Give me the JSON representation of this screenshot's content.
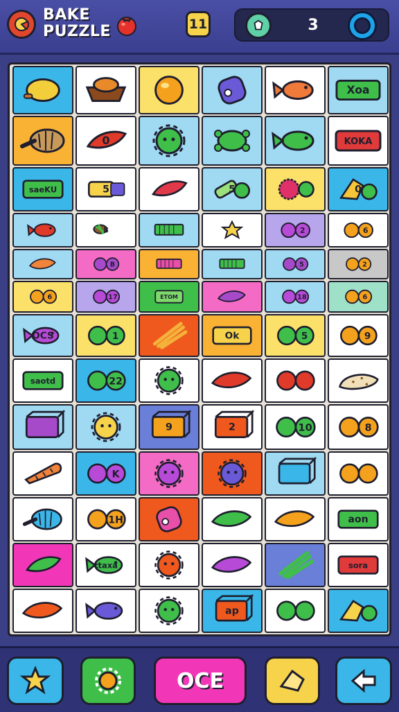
{
  "header": {
    "title_line1": "BAKE",
    "title_line2": "PUZZLE",
    "level": "11",
    "gem_count": "3"
  },
  "board": {
    "rows": [
      [
        {
          "bg": "#3ab7e8",
          "icon": "lemon",
          "c": "#f2cf3a",
          "t": ""
        },
        {
          "bg": "#ffffff",
          "icon": "basket",
          "c": "#e88a2a",
          "t": ""
        },
        {
          "bg": "#fbe06a",
          "icon": "orange",
          "c": "#f4a21e",
          "t": ""
        },
        {
          "bg": "#9fd9f2",
          "icon": "jar",
          "c": "#6a5ad8",
          "t": ""
        },
        {
          "bg": "#ffffff",
          "icon": "fish",
          "c": "#f07a3a",
          "t": ""
        },
        {
          "bg": "#9fd9f2",
          "icon": "tag",
          "c": "#3fbf4a",
          "t": "Xoa"
        }
      ],
      [
        {
          "bg": "#f9b234",
          "icon": "shell",
          "c": "#c89a5a",
          "t": ""
        },
        {
          "bg": "#ffffff",
          "icon": "pepper",
          "c": "#e03a2a",
          "t": "0"
        },
        {
          "bg": "#9fd9f2",
          "icon": "sun",
          "c": "#3fbf4a",
          "t": ""
        },
        {
          "bg": "#9fd9f2",
          "icon": "turtle",
          "c": "#3fbf4a",
          "t": ""
        },
        {
          "bg": "#9fd9f2",
          "icon": "fish",
          "c": "#3fbf4a",
          "t": ""
        },
        {
          "bg": "#ffffff",
          "icon": "tag",
          "c": "#e03a3a",
          "t": "KOKA"
        }
      ],
      [
        {
          "bg": "#3ab7e8",
          "icon": "tag",
          "c": "#3fbf4a",
          "t": "saeKU"
        },
        {
          "bg": "#ffffff",
          "icon": "tube",
          "c": "#f7d34b",
          "t": "5"
        },
        {
          "bg": "#ffffff",
          "icon": "pepper",
          "c": "#e03a4a",
          "t": ""
        },
        {
          "bg": "#9fd9f2",
          "icon": "bottle",
          "c": "#9be07a",
          "t": "5"
        },
        {
          "bg": "#fbe06a",
          "icon": "berry",
          "c": "#e0306a",
          "t": ""
        },
        {
          "bg": "#3ab7e8",
          "icon": "cake",
          "c": "#f7c53a",
          "t": "0"
        }
      ],
      [
        {
          "bg": "#9fd9f2",
          "icon": "fish",
          "c": "#e03a2a",
          "t": ""
        },
        {
          "bg": "#ffffff",
          "icon": "candy",
          "c": "#8a5a2a",
          "t": "8"
        },
        {
          "bg": "#9fd9f2",
          "icon": "bar",
          "c": "#3fbf4a",
          "t": ""
        },
        {
          "bg": "#ffffff",
          "icon": "star",
          "c": "#f7d34b",
          "t": ""
        },
        {
          "bg": "#b7a6ec",
          "icon": "pair",
          "c": "#b84ad8",
          "t": "2"
        },
        {
          "bg": "#ffffff",
          "icon": "pair",
          "c": "#f4a21e",
          "t": "6"
        }
      ],
      [
        {
          "bg": "#9fd9f2",
          "icon": "leaf",
          "c": "#f0843a",
          "t": ""
        },
        {
          "bg": "#f36bc5",
          "icon": "pair",
          "c": "#a64ac9",
          "t": "B"
        },
        {
          "bg": "#f9b234",
          "icon": "bar",
          "c": "#e84fa8",
          "t": ""
        },
        {
          "bg": "#9fd9f2",
          "icon": "bar",
          "c": "#3fbf4a",
          "t": ""
        },
        {
          "bg": "#9fd9f2",
          "icon": "pair",
          "c": "#a64ac9",
          "t": "5"
        },
        {
          "bg": "#c8c8c8",
          "icon": "pair",
          "c": "#f4a21e",
          "t": "2"
        }
      ],
      [
        {
          "bg": "#fbe06a",
          "icon": "pair",
          "c": "#f4a21e",
          "t": "6"
        },
        {
          "bg": "#b7a6ec",
          "icon": "pair",
          "c": "#b84ad8",
          "t": "17"
        },
        {
          "bg": "#3fbf4a",
          "icon": "tag",
          "c": "#7ed86a",
          "t": "ETOM"
        },
        {
          "bg": "#f36bc5",
          "icon": "leaf",
          "c": "#a64ac9",
          "t": ""
        },
        {
          "bg": "#9fd9f2",
          "icon": "pair",
          "c": "#b84ad8",
          "t": "18"
        },
        {
          "bg": "#9fe0c9",
          "icon": "pair",
          "c": "#f4a21e",
          "t": "6"
        }
      ],
      [
        {
          "bg": "#9fd9f2",
          "icon": "fish",
          "c": "#b84ad8",
          "t": "OCS"
        },
        {
          "bg": "#fbe06a",
          "icon": "pair",
          "c": "#3fbf4a",
          "t": "1"
        },
        {
          "bg": "#f0591e",
          "icon": "sticks",
          "c": "#f4b23a",
          "t": ""
        },
        {
          "bg": "#f9b234",
          "icon": "tag",
          "c": "#f7d34b",
          "t": "Ok"
        },
        {
          "bg": "#fbe06a",
          "icon": "pair",
          "c": "#3fbf4a",
          "t": "5"
        },
        {
          "bg": "#ffffff",
          "icon": "pair",
          "c": "#f4a21e",
          "t": "9"
        }
      ],
      [
        {
          "bg": "#ffffff",
          "icon": "tag",
          "c": "#3fbf4a",
          "t": "saotd"
        },
        {
          "bg": "#3ab7e8",
          "icon": "pair",
          "c": "#3fbf4a",
          "t": "22"
        },
        {
          "bg": "#ffffff",
          "icon": "sun",
          "c": "#3fbf4a",
          "t": ""
        },
        {
          "bg": "#ffffff",
          "icon": "leaf",
          "c": "#e03a2a",
          "t": ""
        },
        {
          "bg": "#ffffff",
          "icon": "pair",
          "c": "#e03a2a",
          "t": ""
        },
        {
          "bg": "#ffffff",
          "icon": "cookie",
          "c": "#f0dfb8",
          "t": ""
        }
      ],
      [
        {
          "bg": "#9fd9f2",
          "icon": "box",
          "c": "#a64ac9",
          "t": ""
        },
        {
          "bg": "#9fd9f2",
          "icon": "sun",
          "c": "#f7d34b",
          "t": ""
        },
        {
          "bg": "#6a7fd8",
          "icon": "box",
          "c": "#f4a21e",
          "t": "9"
        },
        {
          "bg": "#ffffff",
          "icon": "box",
          "c": "#f0591e",
          "t": "2"
        },
        {
          "bg": "#ffffff",
          "icon": "pair",
          "c": "#3fbf4a",
          "t": "10"
        },
        {
          "bg": "#ffffff",
          "icon": "pair",
          "c": "#f4a21e",
          "t": "8"
        }
      ],
      [
        {
          "bg": "#ffffff",
          "icon": "carrot",
          "c": "#f0843a",
          "t": ""
        },
        {
          "bg": "#3ab7e8",
          "icon": "pair",
          "c": "#b84ad8",
          "t": "K"
        },
        {
          "bg": "#f36bc5",
          "icon": "sun",
          "c": "#b84ad8",
          "t": ""
        },
        {
          "bg": "#f0591e",
          "icon": "sun",
          "c": "#6a5ad8",
          "t": ""
        },
        {
          "bg": "#9fd9f2",
          "icon": "box",
          "c": "#3ab7e8",
          "t": ""
        },
        {
          "bg": "#ffffff",
          "icon": "pair",
          "c": "#f4a21e",
          "t": ""
        }
      ],
      [
        {
          "bg": "#ffffff",
          "icon": "shell",
          "c": "#3ab7e8",
          "t": ""
        },
        {
          "bg": "#ffffff",
          "icon": "pair",
          "c": "#f4a21e",
          "t": "1H"
        },
        {
          "bg": "#f0591e",
          "icon": "jar",
          "c": "#e84fa8",
          "t": ""
        },
        {
          "bg": "#ffffff",
          "icon": "leaf",
          "c": "#3fbf4a",
          "t": ""
        },
        {
          "bg": "#ffffff",
          "icon": "leaf",
          "c": "#f4a21e",
          "t": ""
        },
        {
          "bg": "#ffffff",
          "icon": "tag",
          "c": "#3fbf4a",
          "t": "aon"
        }
      ],
      [
        {
          "bg": "#f236b8",
          "icon": "pepper",
          "c": "#3fbf4a",
          "t": ""
        },
        {
          "bg": "#ffffff",
          "icon": "fish",
          "c": "#3fbf4a",
          "t": "ttaxa"
        },
        {
          "bg": "#ffffff",
          "icon": "sun",
          "c": "#f0591e",
          "t": ""
        },
        {
          "bg": "#ffffff",
          "icon": "leaf",
          "c": "#b84ad8",
          "t": ""
        },
        {
          "bg": "#6a7fd8",
          "icon": "sticks",
          "c": "#3fbf4a",
          "t": ""
        },
        {
          "bg": "#ffffff",
          "icon": "tag",
          "c": "#e03a3a",
          "t": "sora"
        }
      ],
      [
        {
          "bg": "#ffffff",
          "icon": "leaf",
          "c": "#f0591e",
          "t": ""
        },
        {
          "bg": "#ffffff",
          "icon": "fish",
          "c": "#6a5ad8",
          "t": ""
        },
        {
          "bg": "#ffffff",
          "icon": "sun",
          "c": "#3fbf4a",
          "t": ""
        },
        {
          "bg": "#3ab7e8",
          "icon": "box",
          "c": "#f0591e",
          "t": "ap"
        },
        {
          "bg": "#ffffff",
          "icon": "pair",
          "c": "#3fbf4a",
          "t": ""
        },
        {
          "bg": "#3ab7e8",
          "icon": "cake",
          "c": "#f7d34b",
          "t": ""
        }
      ]
    ]
  },
  "footer": {
    "main_button_label": "OCE",
    "buttons": [
      {
        "bg": "#3ab7e8",
        "icon": "star-icon",
        "c": "#f7d34b"
      },
      {
        "bg": "#3fbf4a",
        "icon": "gear-icon",
        "c": "#f4a21e"
      },
      {
        "bg": "#f236b8",
        "icon": "main",
        "c": "#ffffff"
      },
      {
        "bg": "#f7d34b",
        "icon": "cheese-icon",
        "c": "#f7d34b"
      },
      {
        "bg": "#3ab7e8",
        "icon": "arrow-icon",
        "c": "#ffffff"
      }
    ]
  }
}
